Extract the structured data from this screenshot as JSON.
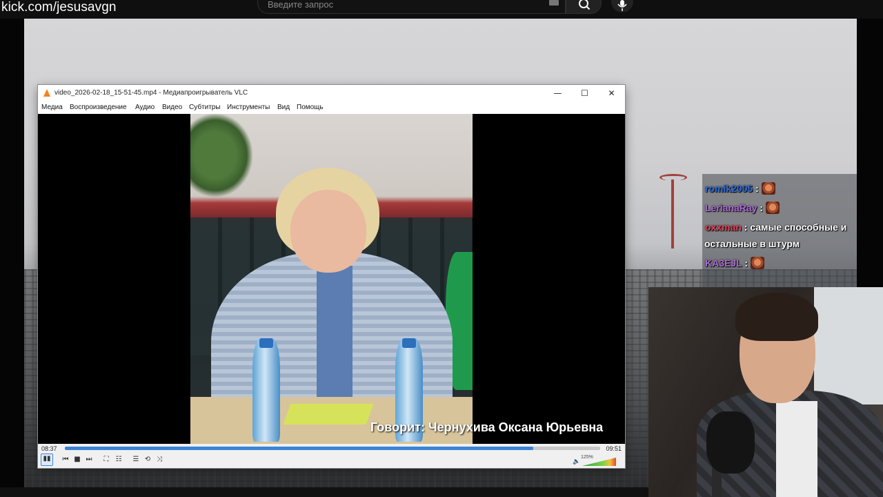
{
  "top_bar": {
    "url": "kick.com/jesusavgn",
    "search_placeholder": "Введите запрос"
  },
  "chat": {
    "messages": [
      {
        "user": "romik2005",
        "user_color": "#2f6bdc",
        "sep": " :",
        "text": "",
        "emote": true
      },
      {
        "user": "LerianaRay",
        "user_color": "#b06ad8",
        "sep": " :",
        "text": "",
        "emote": true
      },
      {
        "user": "oxxman",
        "user_color": "#e0435a",
        "sep": " :",
        "text": " самые способные и",
        "emote": false
      },
      {
        "user": "",
        "user_color": "#ffffff",
        "sep": "",
        "text": "остальные в штурм",
        "emote": false
      },
      {
        "user": "KA3EJL",
        "user_color": "#b06ad8",
        "sep": " :",
        "text": "",
        "emote": true
      }
    ]
  },
  "vlc": {
    "title": "video_2026-02-18_15-51-45.mp4 - Медиапроигрыватель VLC",
    "menu": [
      "Медиа",
      "Воспроизведение",
      "Аудио",
      "Видео",
      "Субтитры",
      "Инструменты",
      "Вид",
      "Помощь"
    ],
    "window_controls": {
      "minimize": "—",
      "maximize": "☐",
      "close": "✕"
    },
    "caption": "Говорит: Чернухива Оксана Юрьевна",
    "time_elapsed": "08:37",
    "time_total": "09:51",
    "progress_fraction": 0.875,
    "volume_label": "125%",
    "volume_fraction": 1.0,
    "controls": {
      "play_pause": "▮▮",
      "prev": "⏮",
      "stop": "■",
      "next": "⏭",
      "fullscreen": "⛶",
      "extended": "☷",
      "playlist": "☰",
      "loop": "⟲",
      "shuffle": "⤨",
      "volume_icon": "🔈"
    },
    "accent_color": "#3a83d4",
    "icon_color": "#f58220"
  }
}
